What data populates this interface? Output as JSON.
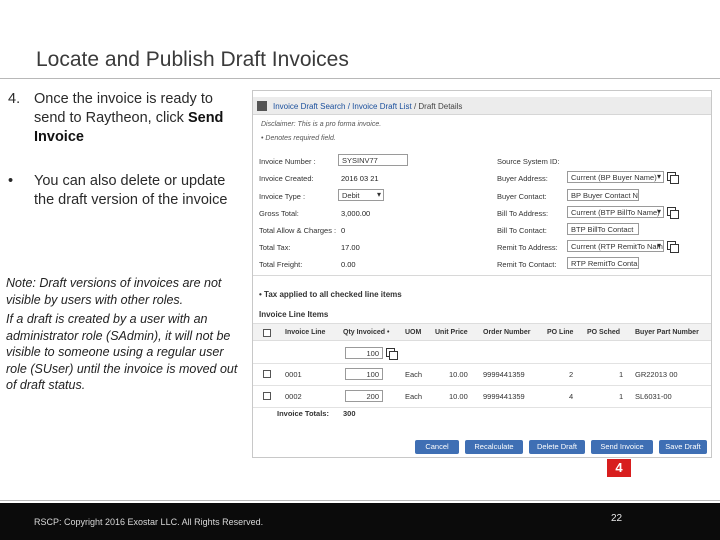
{
  "slide": {
    "title": "Locate and Publish Draft Invoices",
    "step": {
      "number": "4.",
      "text": "Once the invoice is ready to send to Raytheon, click ",
      "bold": "Send Invoice"
    },
    "bullet": {
      "marker": "•",
      "text": "You can also delete or update the draft version of the invoice"
    },
    "note1": "Note: Draft versions of invoices are not visible by users with other roles.",
    "note2": "If a draft is created by a user with an administrator role (SAdmin), it will not be visible to someone using a regular user role (SUser) until the invoice is moved out of draft status.",
    "callout": "4"
  },
  "screenshot": {
    "breadcrumb": {
      "search": "Invoice Draft Search",
      "sep": " / ",
      "list": "Invoice Draft List",
      "current": " / Draft Details"
    },
    "disclaimer": "Disclaimer: This is a pro forma invoice.",
    "required_note": "• Denotes required field.",
    "left_fields": [
      {
        "label": "Invoice Number :",
        "value": "SYSINV77"
      },
      {
        "label": "Invoice Created:",
        "value": "2016 03 21"
      },
      {
        "label": "Invoice Type :",
        "value": "Debit"
      },
      {
        "label": "Gross Total:",
        "value": "3,000.00"
      },
      {
        "label": "Total Allow & Charges :",
        "value": "0"
      },
      {
        "label": "Total Tax:",
        "value": "17.00"
      },
      {
        "label": "Total Freight:",
        "value": "0.00"
      }
    ],
    "right_fields": [
      {
        "label": "Source System ID:",
        "value": ""
      },
      {
        "label": "Buyer Address:",
        "value": "Current (BP Buyer Name)"
      },
      {
        "label": "Buyer Contact:",
        "value": "BP Buyer Contact N"
      },
      {
        "label": "Bill To Address:",
        "value": "Current (BTP BillTo Name)"
      },
      {
        "label": "Bill To Contact:",
        "value": "BTP BillTo Contact"
      },
      {
        "label": "Remit To Address:",
        "value": "Current (RTP RemitTo Nam"
      },
      {
        "label": "Remit To Contact:",
        "value": "RTP RemitTo Conta"
      }
    ],
    "tax_applied": "• Tax applied to all checked line items",
    "line_items_title": "Invoice Line Items",
    "columns": [
      "Invoice Line",
      "Qty Invoiced •",
      "UOM",
      "Unit Price",
      "Order Number",
      "PO Line",
      "PO Sched",
      "Buyer Part Number"
    ],
    "bulk_qty": "100",
    "rows": [
      {
        "line": "0001",
        "qty": "100",
        "uom": "Each",
        "price": "10.00",
        "order": "9999441359",
        "po_line": "2",
        "po_sched": "1",
        "part": "GR22013 00"
      },
      {
        "line": "0002",
        "qty": "200",
        "uom": "Each",
        "price": "10.00",
        "order": "9999441359",
        "po_line": "4",
        "po_sched": "1",
        "part": "SL6031-00"
      }
    ],
    "totals_label": "Invoice Totals:",
    "totals_value": "300",
    "buttons": {
      "cancel": "Cancel",
      "recalculate": "Recalculate",
      "delete": "Delete Draft",
      "send": "Send Invoice",
      "save": "Save Draft"
    }
  },
  "footer": {
    "copyright": "RSCP: Copyright 2016 Exostar LLC. All Rights Reserved.",
    "page_number": "22"
  },
  "colors": {
    "button_blue": "#3f6fb4",
    "link_blue": "#1a4f9c",
    "callout_red": "#d81e1e",
    "footer_black": "#0b0b0b"
  }
}
